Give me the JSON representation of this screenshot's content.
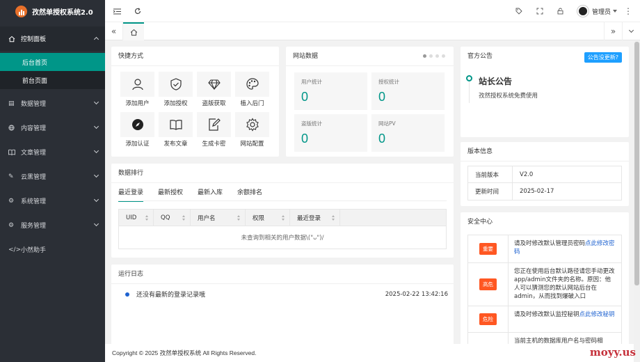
{
  "app": {
    "title": "孜然单授权系统2.0"
  },
  "sidebar": {
    "dashboard": "控制面板",
    "sub": [
      "后台首页",
      "前台页面"
    ],
    "items": [
      {
        "label": "数据管理",
        "icon": "database-icon"
      },
      {
        "label": "内容管理",
        "icon": "globe-icon"
      },
      {
        "label": "文章管理",
        "icon": "book-icon"
      },
      {
        "label": "云黑管理",
        "icon": "pen-icon"
      },
      {
        "label": "系统管理",
        "icon": "gear-icon"
      },
      {
        "label": "服务管理",
        "icon": "settings-icon"
      },
      {
        "label": "小然助手",
        "icon": "code-icon"
      }
    ]
  },
  "header": {
    "user": "管理员"
  },
  "quick": {
    "title": "快捷方式",
    "items": [
      "添加用户",
      "添加授权",
      "盗版获取",
      "植入后门",
      "添加认证",
      "发布文章",
      "生成卡密",
      "网站配置"
    ]
  },
  "site_data": {
    "title": "网站数据",
    "stats": [
      {
        "label": "用户统计",
        "value": "0"
      },
      {
        "label": "授权统计",
        "value": "0"
      },
      {
        "label": "盗版统计",
        "value": "0"
      },
      {
        "label": "网站PV",
        "value": "0"
      }
    ]
  },
  "rank": {
    "title": "数据排行",
    "tabs": [
      "最近登录",
      "最新授权",
      "最新入库",
      "余额排名"
    ],
    "columns": [
      "UID",
      "QQ",
      "用户名",
      "权限",
      "最近登录"
    ],
    "empty": "未查询到相关的用户数据\\(\"ᴗ\")/"
  },
  "log": {
    "title": "运行日志",
    "entry": "还没有最新的登录记录哦",
    "time": "2025-02-22 13:42:16"
  },
  "notice": {
    "title": "官方公告",
    "button": "公告没更新?",
    "heading": "站长公告",
    "body": "孜然授权系统免费使用"
  },
  "version": {
    "title": "版本信息",
    "rows": [
      {
        "key": "当前版本",
        "value": "V2.0"
      },
      {
        "key": "更新时间",
        "value": "2025-02-17"
      }
    ]
  },
  "security": {
    "title": "安全中心",
    "rows": [
      {
        "level": "重要",
        "text": "请及时修改默认管理员密码",
        "link": "点此修改密码"
      },
      {
        "level": "高危",
        "text": "您正在使用后台默认路径请您手动更改app/admin文件夹的名称。原因：他人可以猜测您的默认网站后台在admin，从而找到爆破入口",
        "link": ""
      },
      {
        "level": "危险",
        "text": "请及时修改默认监控秘钥",
        "link": "点此修改秘钥"
      },
      {
        "level": "",
        "text": "当前主机的数据库用户名与密码相",
        "link": ""
      }
    ]
  },
  "footer": {
    "text": "Copyright © 2025 孜然单授权系统 All Rights Reserved."
  },
  "watermark": "moyy.us",
  "colors": {
    "accent": "#009688",
    "danger": "#ff5722",
    "link": "#1e62d0",
    "notice": "#1e9fff"
  }
}
